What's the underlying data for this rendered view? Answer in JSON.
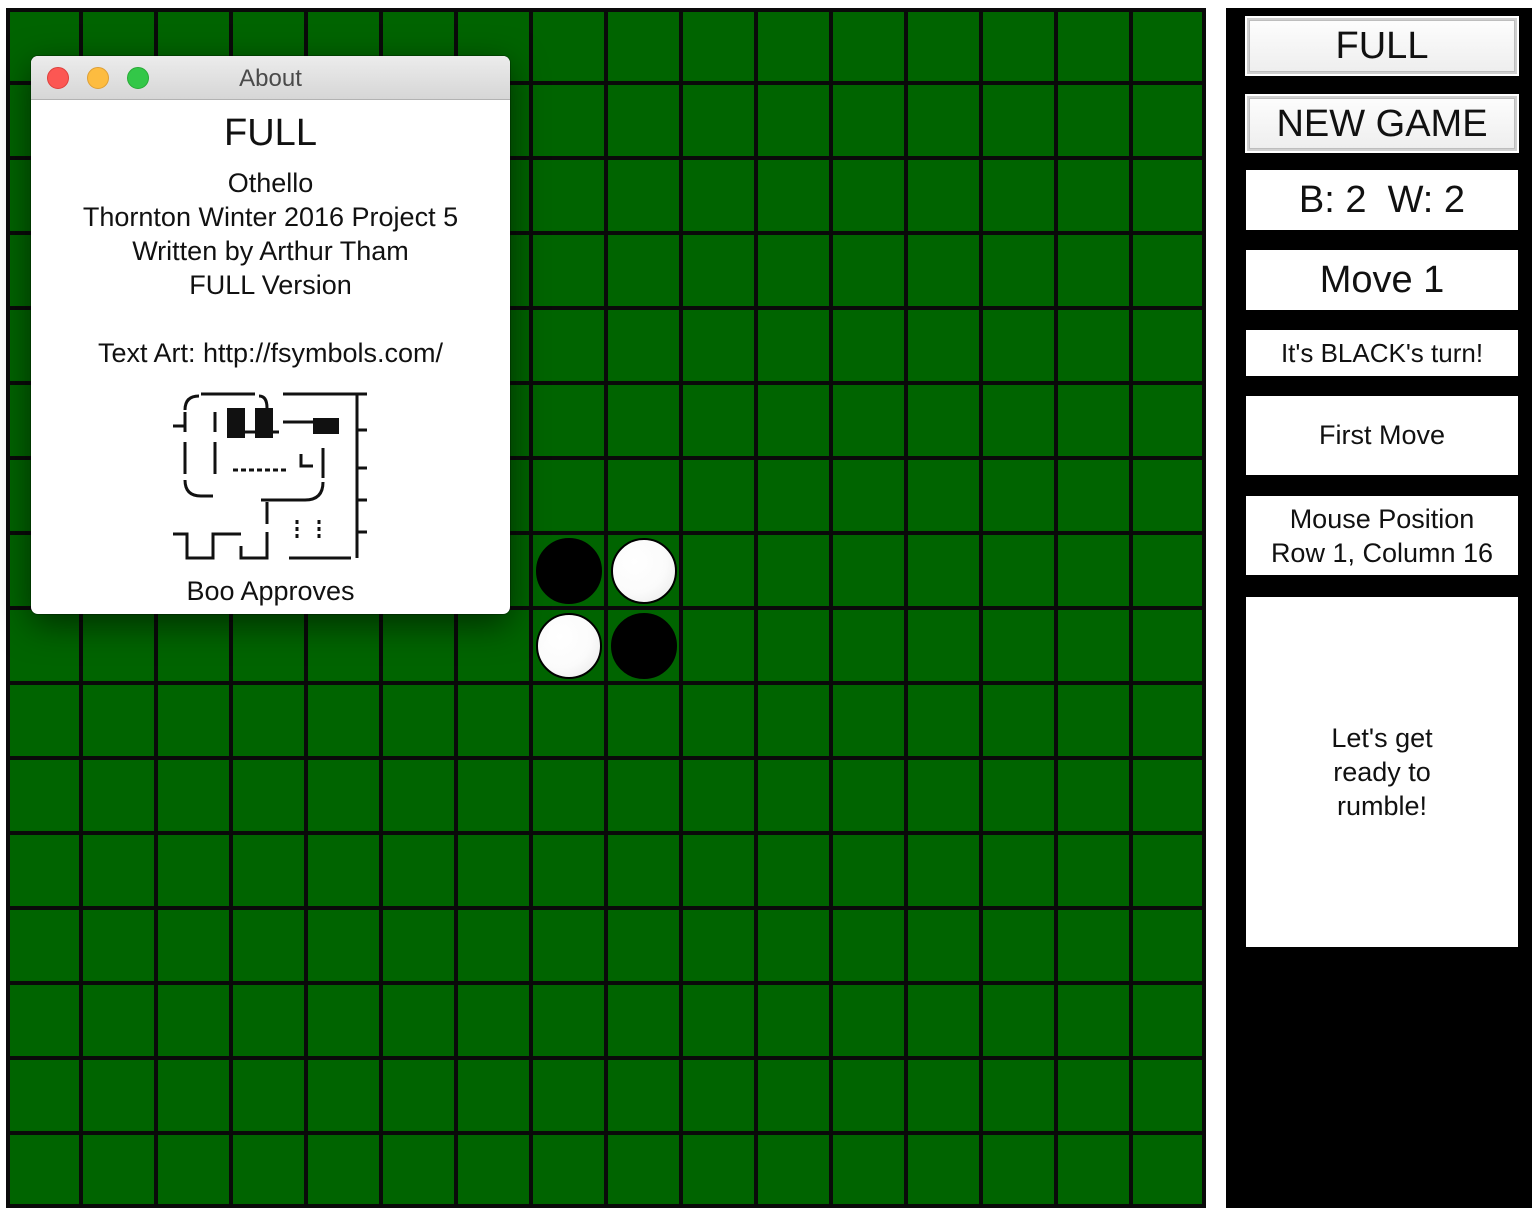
{
  "board": {
    "rows": 16,
    "columns": 16,
    "colors": {
      "felt": "#006400",
      "grid": "#0a0a0a"
    },
    "discs": [
      {
        "row": 8,
        "column": 8,
        "color": "black"
      },
      {
        "row": 8,
        "column": 9,
        "color": "white"
      },
      {
        "row": 9,
        "column": 8,
        "color": "white"
      },
      {
        "row": 9,
        "column": 9,
        "color": "black"
      }
    ]
  },
  "sidebar": {
    "mode_button": "FULL",
    "new_game_button": "NEW GAME",
    "score": "B: 2  W: 2",
    "move": "Move 1",
    "turn": "It's BLACK's turn!",
    "last_move": "First Move",
    "mouse_position": {
      "label": "Mouse Position",
      "value": "Row 1, Column 16"
    },
    "message": "Let's get\nready to\nrumble!"
  },
  "about_dialog": {
    "title": "About",
    "heading": "FULL",
    "lines": [
      "Othello",
      "Thornton Winter 2016 Project 5",
      "Written by Arthur Tham",
      "FULL Version"
    ],
    "credit": "Text Art: http://fsymbols.com/",
    "art_icon": "boo-dog-text-art",
    "caption": "Boo Approves"
  }
}
